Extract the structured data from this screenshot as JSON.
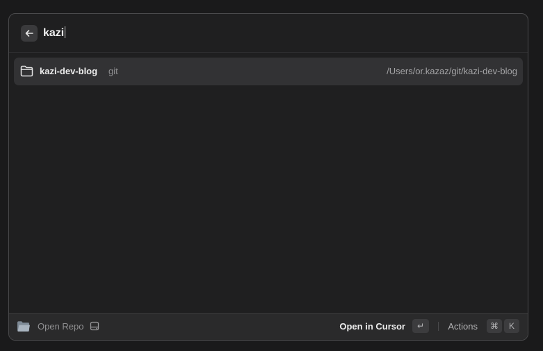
{
  "search": {
    "query": "kazi",
    "back_icon": "arrow-left-icon"
  },
  "results": [
    {
      "icon": "folder-icon",
      "title": "kazi-dev-blog",
      "subtitle": "git",
      "path": "/Users/or.kazaz/git/kazi-dev-blog"
    }
  ],
  "footer": {
    "left_icon": "folder-icon",
    "left_label": "Open Repo",
    "left_secondary_icon": "drive-icon",
    "primary_action": "Open in Cursor",
    "primary_key": "↵",
    "actions_label": "Actions",
    "actions_keys": [
      "⌘",
      "K"
    ]
  },
  "colors": {
    "background": "#1f1f20",
    "selected_row": "#323234",
    "footer": "#2a2a2b",
    "text_primary": "#ececec",
    "text_secondary": "#8e8e90"
  }
}
